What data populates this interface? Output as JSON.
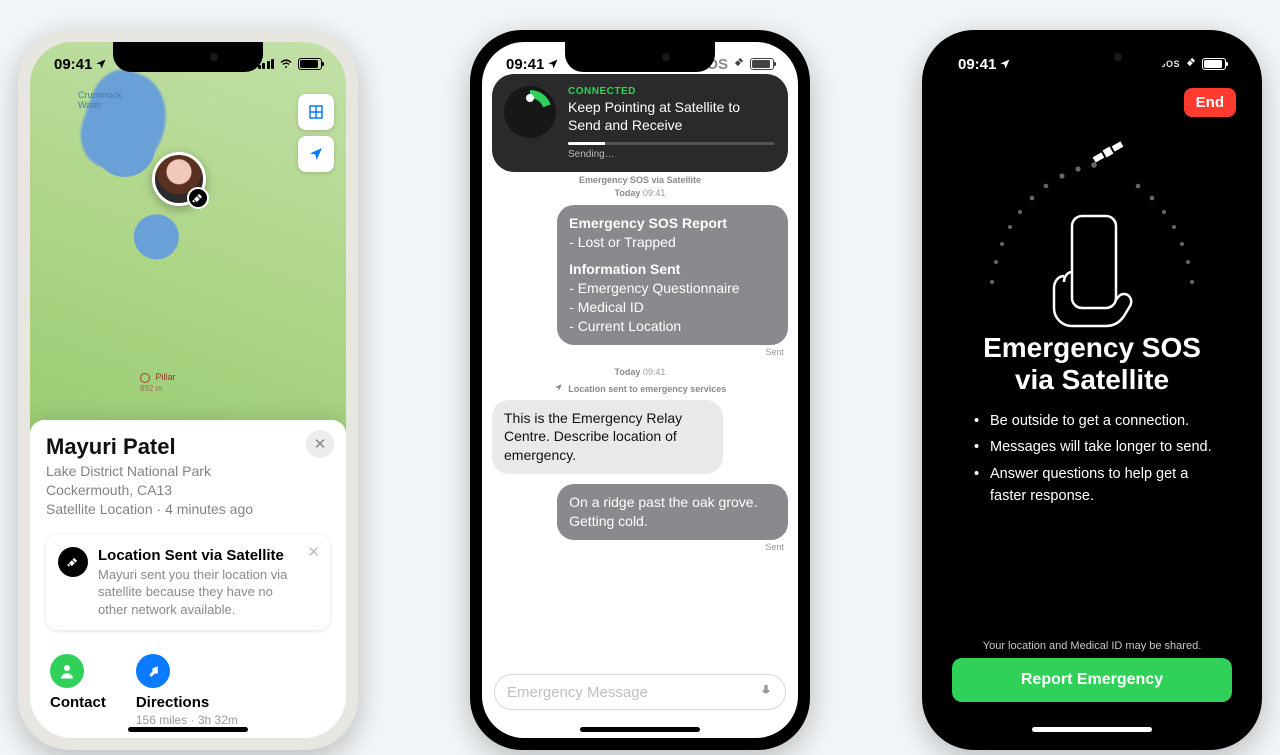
{
  "status": {
    "time": "09:41",
    "sos": "SOS"
  },
  "phone1": {
    "map_labels": {
      "crummock": "Crummock\nWater",
      "pillar": "Pillar",
      "pillar_elev": "892 m"
    },
    "contact": {
      "name": "Mayuri Patel",
      "place": "Lake District National Park",
      "town": "Cockermouth, CA13",
      "meta": "Satellite Location · 4 minutes ago"
    },
    "sat_card": {
      "title": "Location Sent via Satellite",
      "desc": "Mayuri sent you their location via satellite because they have no other network available."
    },
    "actions": {
      "contact": "Contact",
      "directions": "Directions",
      "directions_sub": "156 miles · 3h 32m"
    }
  },
  "phone2": {
    "hud": {
      "connected": "CONNECTED",
      "headline": "Keep Pointing at Satellite to Send and Receive",
      "sending": "Sending…"
    },
    "thread_title": "Emergency SOS via Satellite",
    "today": "Today",
    "time": "09:41",
    "report": {
      "title": "Emergency SOS Report",
      "reason": "Lost or Trapped",
      "info_title": "Information Sent",
      "info_items": [
        "Emergency Questionnaire",
        "Medical ID",
        "Current Location"
      ]
    },
    "sent": "Sent",
    "sys_loc": "Location sent to emergency services",
    "incoming": "This is the Emergency Relay Centre. Describe location of emergency.",
    "outgoing2": "On a ridge past the oak grove. Getting cold.",
    "input_placeholder": "Emergency Message"
  },
  "phone3": {
    "end": "End",
    "title_l1": "Emergency SOS",
    "title_l2": "via Satellite",
    "tips": [
      "Be outside to get a connection.",
      "Messages will take longer to send.",
      "Answer questions to help get a faster response."
    ],
    "disclaimer": "Your location and Medical ID may be shared.",
    "cta": "Report Emergency"
  }
}
